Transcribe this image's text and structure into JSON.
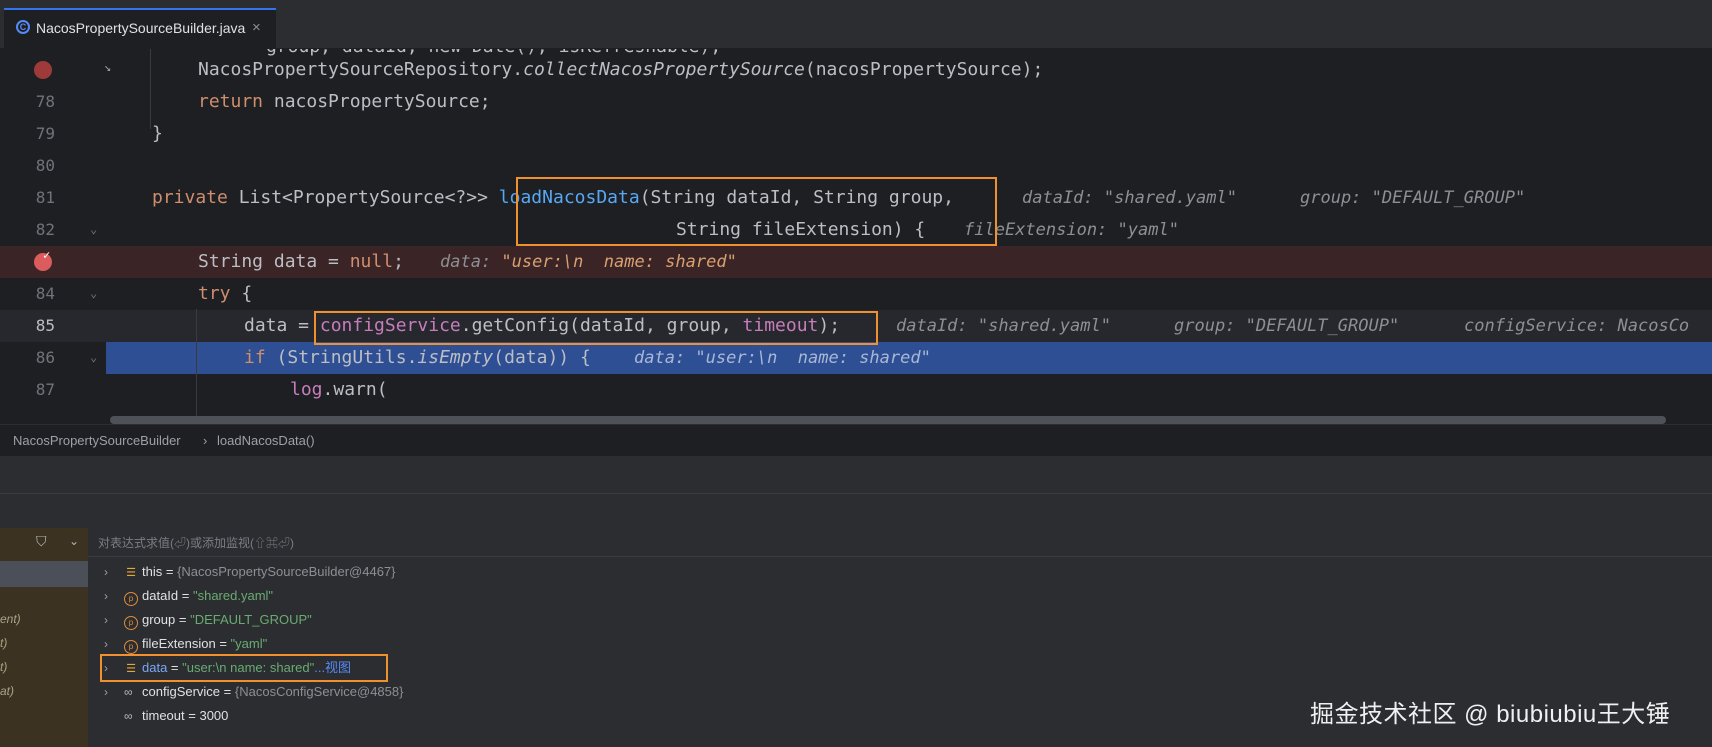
{
  "tab": {
    "title": "NacosPropertySourceBuilder.java",
    "close": "×",
    "icon": "C"
  },
  "editor": {
    "partial_line": "group, dataId, new Date(), isRefreshable);",
    "lines": [
      {
        "num": "",
        "l77": "NacosPropertySourceRepository.",
        "l77b": "collectNacosPropertySource",
        "l77c": "(nacosPropertySource);"
      },
      {
        "num": "78",
        "kw": "return",
        "rest": " nacosPropertySource;"
      },
      {
        "num": "79",
        "text": "}"
      },
      {
        "num": "80"
      },
      {
        "num": "81",
        "kw": "private",
        "a": " List<PropertySource<?>> ",
        "fn": "loadNacosData",
        "b": "(String dataId, String group,",
        "h1": "dataId: ",
        "h1v": "\"shared.yaml\"",
        "h2": "group: ",
        "h2v": "\"DEFAULT_GROUP\""
      },
      {
        "num": "82",
        "a": "String fileExtension) {",
        "h1": "fileExtension: ",
        "h1v": "\"yaml\""
      },
      {
        "num": "",
        "a": "String data = ",
        "kw": "null",
        "b": ";",
        "h1": "data: ",
        "h1v": "\"user:\\n  name: shared\""
      },
      {
        "num": "84",
        "kw": "try",
        "a": " {"
      },
      {
        "num": "85",
        "a": "data = ",
        "f1": "configService",
        "b": ".getConfig(dataId, group, ",
        "f2": "timeout",
        "c": ");",
        "h1": "dataId: ",
        "h1v": "\"shared.yaml\"",
        "h2": "group: ",
        "h2v": "\"DEFAULT_GROUP\"",
        "h3": "configService: NacosCo"
      },
      {
        "num": "86",
        "kw": "if",
        "a": " (StringUtils.",
        "it": "isEmpty",
        "b": "(data)) {",
        "h1": "data: ",
        "h1v": "\"user:\\n  name: shared\""
      },
      {
        "num": "87",
        "f1": "log",
        "a": ".warn("
      }
    ]
  },
  "breadcrumb": {
    "class": "NacosPropertySourceBuilder",
    "sep": "›",
    "method": "loadNacosData()"
  },
  "debug": {
    "eval_placeholder": "对表达式求值(⏎)或添加监视(⇧⌘⏎)",
    "frames": [
      "ent)",
      "t)",
      "t)",
      "at)"
    ],
    "vars": [
      {
        "name": "this",
        "eq": " = ",
        "value": "{NacosPropertySourceBuilder@4467}"
      },
      {
        "name": "dataId",
        "eq": " = ",
        "value": "\"shared.yaml\""
      },
      {
        "name": "group",
        "eq": " = ",
        "value": "\"DEFAULT_GROUP\""
      },
      {
        "name": "fileExtension",
        "eq": " = ",
        "value": "\"yaml\""
      },
      {
        "name": "data",
        "eq": " = ",
        "value": "\"user:\\n  name: shared\"",
        "link": "...视图"
      },
      {
        "name": "configService",
        "eq": " = ",
        "value": "{NacosConfigService@4858}"
      },
      {
        "name": "timeout",
        "eq": " = ",
        "value": "3000"
      }
    ]
  },
  "watermark": "掘金技术社区 @ biubiubiu王大锤",
  "colors": {
    "accent": "#3574f0",
    "highlight_box": "#f0902e",
    "breakpoint": "#db5c5c",
    "exec_line": "#2e4f93"
  }
}
